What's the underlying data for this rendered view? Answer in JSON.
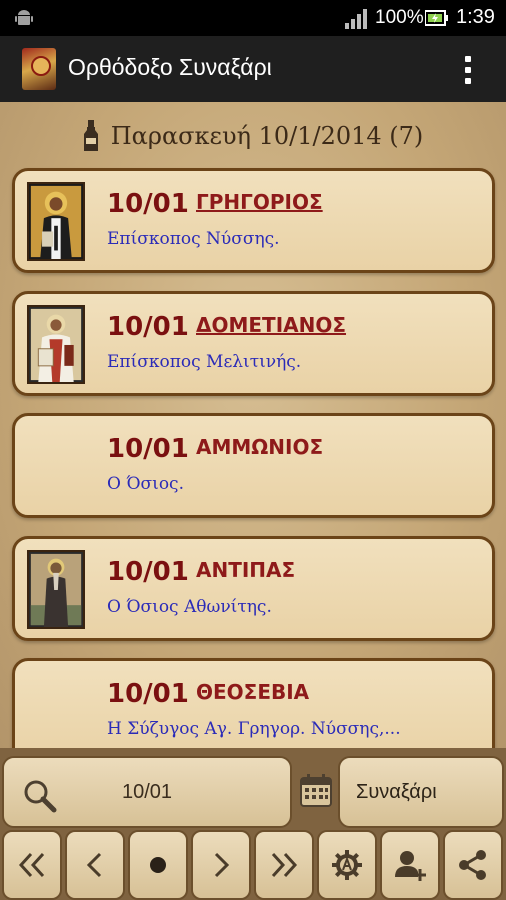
{
  "status_bar": {
    "battery_percent": "100%",
    "time": "1:39"
  },
  "action_bar": {
    "title": "Ορθόδοξο Συναξάρι",
    "overflow_icon": "overflow-menu-icon"
  },
  "date_header": "Παρασκευή 10/1/2014 (7)",
  "saints": [
    {
      "date": "10/01",
      "name": "ΓΡΗΓΟΡΙΟΣ",
      "description": "Επίσκοπος Νύσσης.",
      "has_icon": true,
      "linked": true
    },
    {
      "date": "10/01",
      "name": "ΔΟΜΕΤΙΑΝΟΣ",
      "description": "Επίσκοπος Μελιτινής.",
      "has_icon": true,
      "linked": true
    },
    {
      "date": "10/01",
      "name": "ΑΜΜΩΝΙΟΣ",
      "description": "Ο Όσιος.",
      "has_icon": false,
      "linked": false
    },
    {
      "date": "10/01",
      "name": "ΑΝΤΙΠΑΣ",
      "description": "Ο Όσιος Αθωνίτης.",
      "has_icon": true,
      "linked": false
    },
    {
      "date": "10/01",
      "name": "ΘΕΟΣΕΒΙΑ",
      "description": "Η Σύζυγος Αγ. Γρηγορ. Νύσσης,...",
      "has_icon": false,
      "linked": false
    }
  ],
  "bottom": {
    "search_value": "10/01",
    "source_label": "Συναξάρι"
  },
  "colors": {
    "accent_red": "#8e1a1a",
    "description_blue": "#2b2bb8",
    "card_border": "#6b4418"
  }
}
